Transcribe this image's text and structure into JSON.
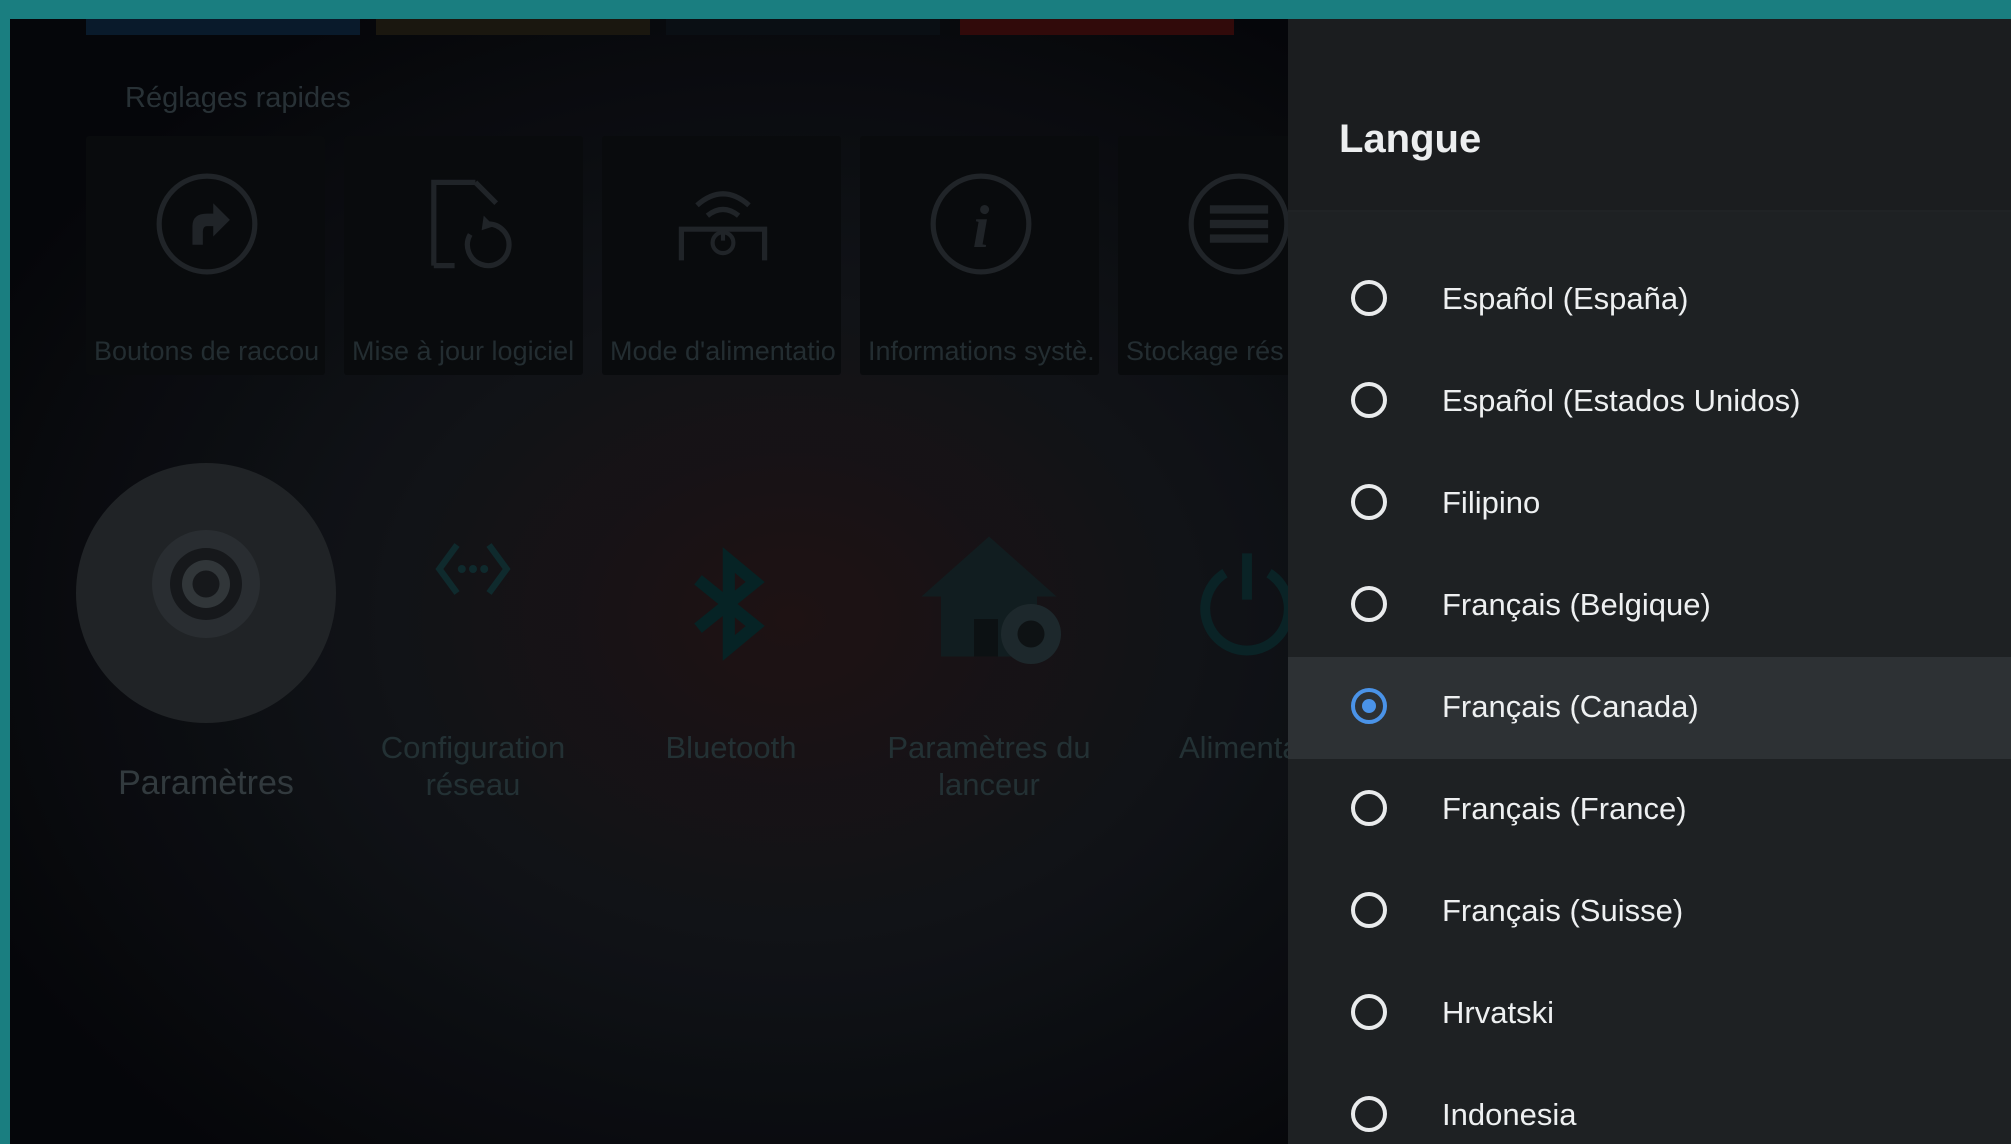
{
  "background": {
    "section_title": "Réglages rapides",
    "quick_tiles": [
      {
        "label": "Boutons de raccou...",
        "icon": "shortcut-icon"
      },
      {
        "label": "Mise à jour logiciel",
        "icon": "software-update-icon"
      },
      {
        "label": "Mode d'alimentation",
        "icon": "power-mode-icon"
      },
      {
        "label": "Informations systè...",
        "icon": "info-icon"
      },
      {
        "label": "Stockage rés",
        "icon": "storage-icon"
      }
    ],
    "apps": [
      {
        "label": "Paramètres",
        "icon": "settings-icon"
      },
      {
        "label": "Configuration réseau",
        "icon": "network-icon"
      },
      {
        "label": "Bluetooth",
        "icon": "bluetooth-icon"
      },
      {
        "label": "Paramètres du lanceur",
        "icon": "launcher-settings-icon"
      },
      {
        "label": "Alimentati",
        "icon": "power-icon"
      }
    ]
  },
  "panel": {
    "title": "Langue",
    "options": [
      {
        "label": "Español (España)",
        "selected": false
      },
      {
        "label": "Español (Estados Unidos)",
        "selected": false
      },
      {
        "label": "Filipino",
        "selected": false
      },
      {
        "label": "Français (Belgique)",
        "selected": false
      },
      {
        "label": "Français (Canada)",
        "selected": true
      },
      {
        "label": "Français (France)",
        "selected": false
      },
      {
        "label": "Français (Suisse)",
        "selected": false
      },
      {
        "label": "Hrvatski",
        "selected": false
      },
      {
        "label": "Indonesia",
        "selected": false
      }
    ]
  },
  "colors": {
    "accent": "#4a93e8",
    "frame": "#1a7e80",
    "panel_bg": "#1e2123"
  }
}
